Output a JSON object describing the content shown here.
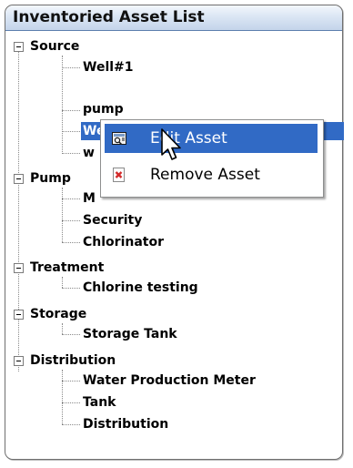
{
  "panel": {
    "title": "Inventoried Asset List"
  },
  "tree": [
    {
      "label": "Source",
      "expanded": true,
      "children": [
        "Well#1",
        "pump",
        "Well",
        "w"
      ]
    },
    {
      "label": "Pump",
      "expanded": true,
      "children": [
        "M",
        "Security",
        "Chlorinator"
      ]
    },
    {
      "label": "Treatment",
      "expanded": true,
      "children": [
        "Chlorine testing"
      ]
    },
    {
      "label": "Storage",
      "expanded": true,
      "children": [
        "Storage Tank"
      ]
    },
    {
      "label": "Distribution",
      "expanded": true,
      "children": [
        "Water Production Meter",
        "Tank",
        "Distribution"
      ]
    }
  ],
  "selected_node": "Well",
  "context_menu": {
    "items": [
      {
        "label": "Edit Asset",
        "icon": "edit-asset-icon",
        "highlighted": true
      },
      {
        "label": "Remove Asset",
        "icon": "remove-x-icon",
        "highlighted": false
      }
    ]
  },
  "colors": {
    "selection": "#316ac5",
    "title_gradient_top": "#f3f7fc",
    "title_gradient_bottom": "#c4d4ea",
    "remove_icon": "#d32b2b"
  }
}
